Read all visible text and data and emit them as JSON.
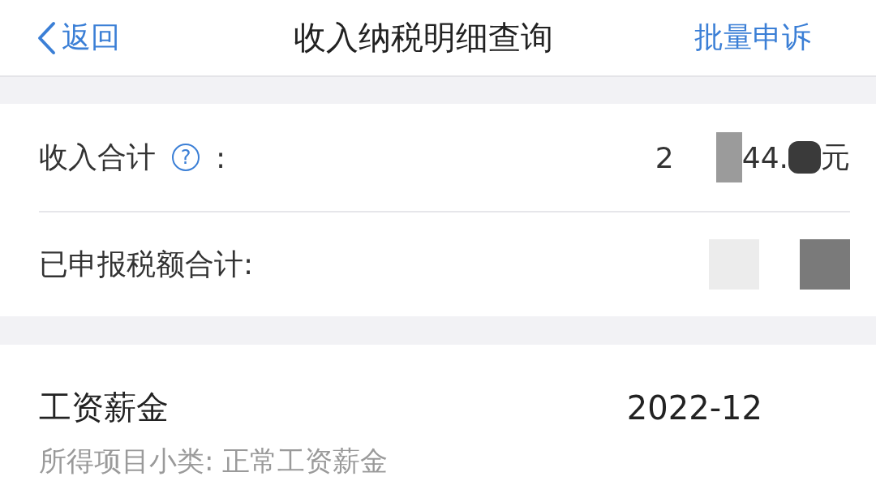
{
  "nav": {
    "back": "返回",
    "title": "收入纳税明细查询",
    "action": "批量申诉"
  },
  "summary": [
    {
      "label": "收入合计",
      "help": "?",
      "colon": ":",
      "value": [
        {
          "kind": "text",
          "text": "2"
        },
        {
          "kind": "light"
        },
        {
          "kind": "text",
          "text": "44."
        },
        {
          "kind": "dark"
        },
        {
          "kind": "text",
          "text": "元"
        }
      ]
    },
    {
      "label": "已申报税额合计:",
      "value": [
        {
          "kind": "light"
        },
        {
          "kind": "dark"
        }
      ]
    }
  ],
  "records": [
    {
      "type": "工资薪金",
      "period": "2022-12",
      "subtype": "所得项目小类: 正常工资薪金"
    }
  ]
}
